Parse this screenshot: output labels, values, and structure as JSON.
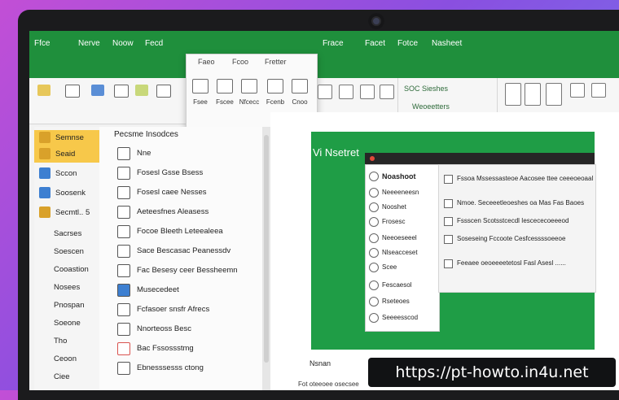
{
  "ribbon": {
    "tabs": [
      "Ffce",
      "Nerve",
      "Noow",
      "Fecd",
      "Frace",
      "Facet",
      "Fotce",
      "Nasheet"
    ],
    "popup_tabs": [
      "Faeo",
      "Fcoo",
      "Fretter"
    ],
    "popup_buttons": [
      "Fsee",
      "Fscee",
      "Nfcecc",
      "Fcenb",
      "Cnoo"
    ],
    "right_labels": [
      "SOC Sieshes",
      "Weoeetters"
    ]
  },
  "nav": {
    "items": [
      {
        "label": "Semnse",
        "selected": true
      },
      {
        "label": "Seaid",
        "selected": true
      },
      {
        "label": "Sccon",
        "selected": false
      },
      {
        "label": "Soosenk",
        "selected": false
      },
      {
        "label": "Secmtl.. 5",
        "selected": false
      },
      {
        "label": "Sacrses",
        "selected": false
      },
      {
        "label": "Soescen",
        "selected": false
      },
      {
        "label": "Cooastion",
        "selected": false
      },
      {
        "label": "Nosees",
        "selected": false
      },
      {
        "label": "Pnospan",
        "selected": false
      },
      {
        "label": "Soeone",
        "selected": false
      },
      {
        "label": "Tho",
        "selected": false
      },
      {
        "label": "Ceoon",
        "selected": false
      },
      {
        "label": "Ciee",
        "selected": false
      }
    ]
  },
  "list": {
    "header": "Pecsme Insodces",
    "items": [
      "Nne",
      "Fosesl Gsse Bsess",
      "Fosesl caee Nesses",
      "Aeteesfnes Aleasess",
      "Focoe Bleeth Leteealeea",
      "Sace Bescasac Peanessdv",
      "Fac Besesy ceer Bessheemn",
      "Musecedeet",
      "Fcfasoer snsfr Afrecs",
      "Nnorteoss Besc",
      "Bac Fssossstmg",
      "Ebnesssesss ctong"
    ]
  },
  "preview": {
    "title": "Vi Nsetret",
    "sub_items": [
      "Noashoot",
      "Neeeeneesn",
      "Nooshet",
      "Frosesc",
      "Neeoeseeel",
      "Nlseacceset",
      "Scee",
      "Fescaesol",
      "Rseteoes",
      "Seeeesscod"
    ],
    "details": [
      "Fssoa Mssessasteoe Aacosee ttee ceeeoeoaal",
      "Nmoe. Seceeetleoeshes oa Mas Fas Baoes",
      "Fssscen Scotsstcecdl Iescececoeeeod",
      "Soseseing Fccoote Cesfcessssoeeoe",
      "Feeaee oeoeeeetetosl Fasl Asesl ......"
    ],
    "bottom_label": "Nsnan",
    "bottom_strip": "Fot oteeoee osecsee"
  },
  "watermark": "https://pt-howto.in4u.net",
  "colors": {
    "excel_green": "#1f8f3c",
    "preview_green": "#1f9d46",
    "selected_nav": "#f7c84a"
  }
}
